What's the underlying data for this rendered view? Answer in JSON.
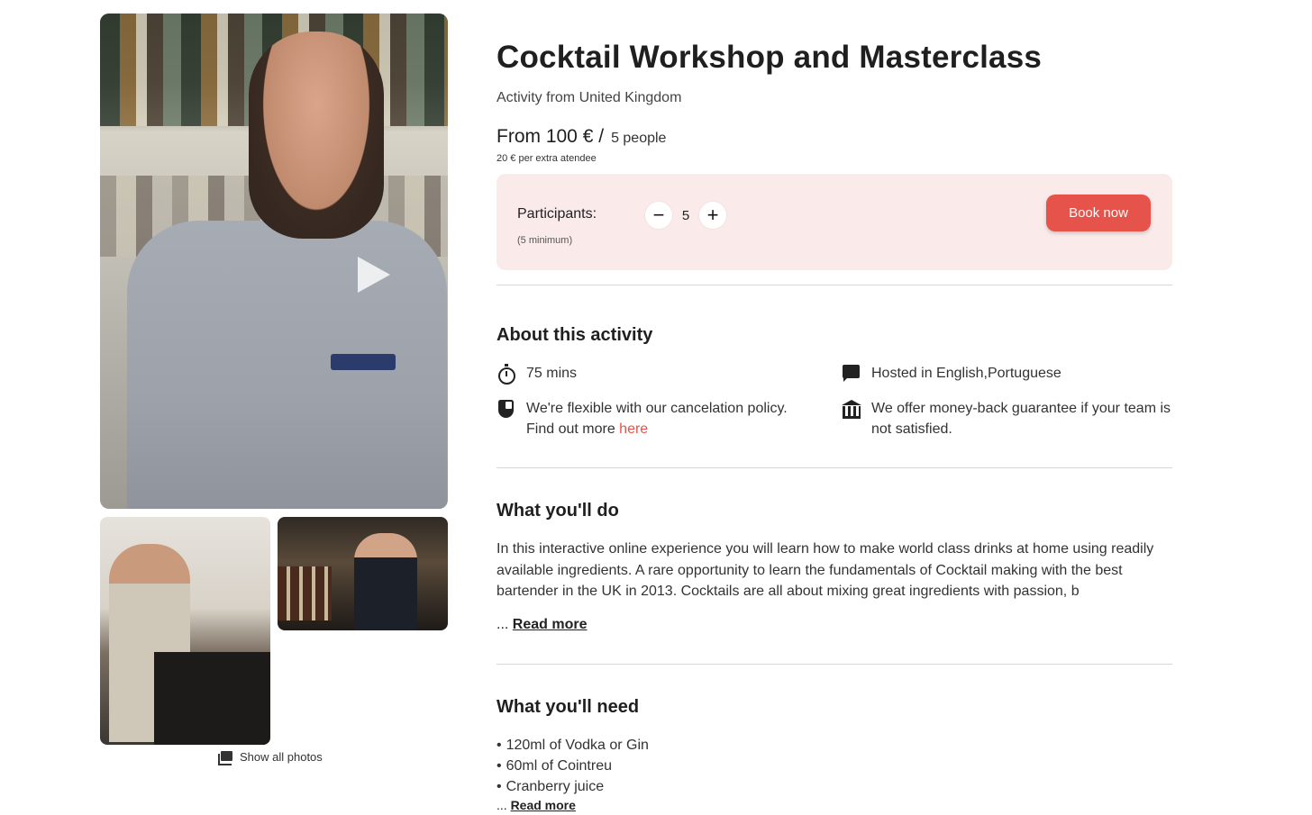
{
  "media": {
    "show_all_photos": "Show all photos"
  },
  "activity": {
    "title": "Cocktail Workshop and Masterclass",
    "subtitle": "Activity from United Kingdom",
    "price": "From 100 € /",
    "price_people": "5 people",
    "extra_price": "20 € per extra atendee"
  },
  "booking": {
    "participants_label": "Participants:",
    "minimum_note": "(5 minimum)",
    "participants_value": "5",
    "decrement": "−",
    "increment": "+",
    "book_button": "Book now",
    "accent_color": "#e5534b",
    "panel_color": "#faeaea"
  },
  "about": {
    "heading": "About this activity",
    "duration": "75 mins",
    "languages": "Hosted in English,Portuguese",
    "cancel_policy": "We're flexible with our cancelation policy.",
    "cancel_more": "Find out more",
    "cancel_link": "here",
    "guarantee": "We offer money-back guarantee if your team is not satisfied."
  },
  "do": {
    "heading": "What you'll do",
    "text": "In this interactive online experience you will learn how to make world class drinks at home using readily available ingredients. A rare opportunity to learn the fundamentals of Cocktail making with the best bartender in the UK in 2013. Cocktails are all about mixing great ingredients with passion, b",
    "ellipsis": "...",
    "read_more": "Read more"
  },
  "need": {
    "heading": "What you'll need",
    "items": [
      "120ml of Vodka or Gin",
      "60ml of Cointreu",
      "Cranberry juice"
    ],
    "ellipsis": "...",
    "read_more": "Read more"
  }
}
